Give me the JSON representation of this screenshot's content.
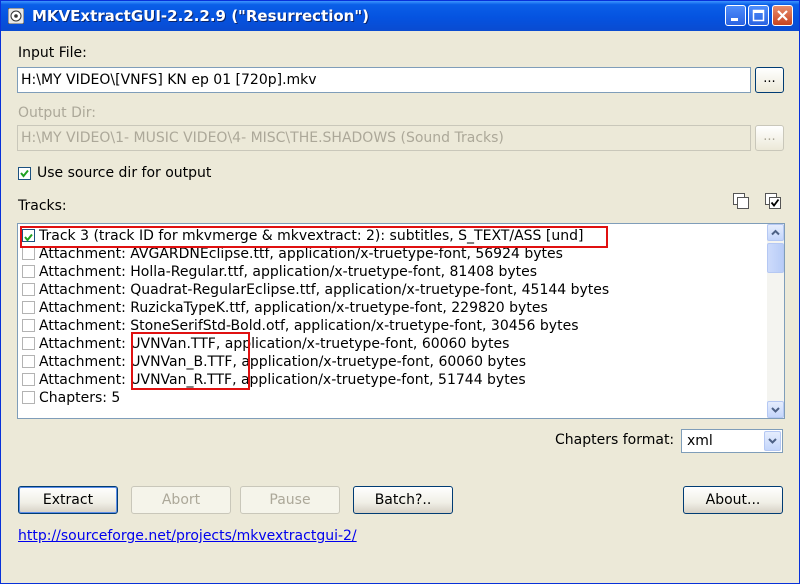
{
  "window": {
    "title": "MKVExtractGUI-2.2.2.9 (\"Resurrection\")"
  },
  "input": {
    "label": "Input File:",
    "value": "H:\\MY VIDEO\\[VNFS] KN ep 01 [720p].mkv",
    "browse_label": "..."
  },
  "output": {
    "label": "Output Dir:",
    "value": "H:\\MY VIDEO\\1- MUSIC VIDEO\\4- MISC\\THE.SHADOWS (Sound Tracks)",
    "browse_label": "...",
    "use_source_label": "Use source dir for output",
    "use_source_checked": true
  },
  "tracks": {
    "label": "Tracks:",
    "items": [
      {
        "label": "Track 3 (track ID for mkvmerge & mkvextract: 2): subtitles, S_TEXT/ASS [und]",
        "checked": true
      },
      {
        "label": "Attachment: AVGARDNEclipse.ttf, application/x-truetype-font, 56924 bytes",
        "checked": false
      },
      {
        "label": "Attachment: Holla-Regular.ttf, application/x-truetype-font, 81408 bytes",
        "checked": false
      },
      {
        "label": "Attachment: Quadrat-RegularEclipse.ttf, application/x-truetype-font, 45144 bytes",
        "checked": false
      },
      {
        "label": "Attachment: RuzickaTypeK.ttf, application/x-truetype-font, 229820 bytes",
        "checked": false
      },
      {
        "label": "Attachment: StoneSerifStd-Bold.otf, application/x-truetype-font, 30456 bytes",
        "checked": false
      },
      {
        "label": "Attachment: UVNVan.TTF, application/x-truetype-font, 60060 bytes",
        "checked": false
      },
      {
        "label": "Attachment: UVNVan_B.TTF, application/x-truetype-font, 60060 bytes",
        "checked": false
      },
      {
        "label": "Attachment: UVNVan_R.TTF, application/x-truetype-font, 51744 bytes",
        "checked": false
      },
      {
        "label": "Chapters: 5",
        "checked": false
      }
    ]
  },
  "chapters_format": {
    "label": "Chapters format:",
    "selected": "xml"
  },
  "buttons": {
    "extract": "Extract",
    "abort": "Abort",
    "pause": "Pause",
    "batch": "Batch?..",
    "about": "About..."
  },
  "link": "http://sourceforge.net/projects/mkvextractgui-2/",
  "colors": {
    "titlebar": "#0553e0",
    "highlight_box": "#e01010",
    "link": "#0000ee"
  }
}
